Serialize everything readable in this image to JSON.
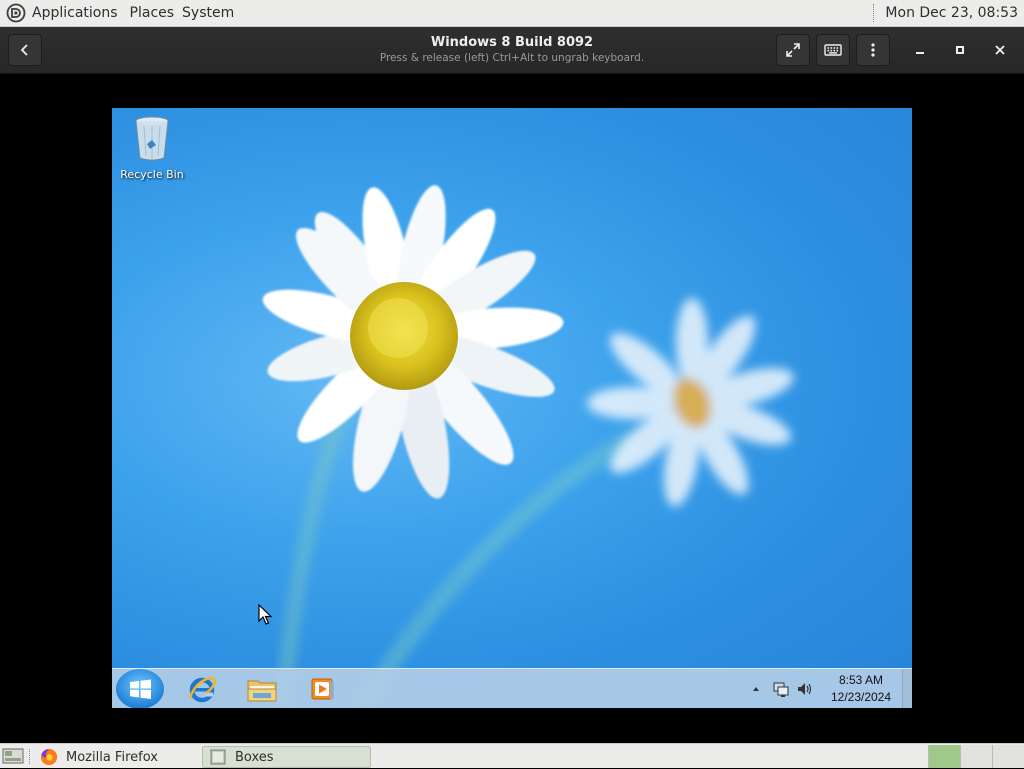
{
  "top_panel": {
    "menus": [
      "Applications",
      "Places",
      "System"
    ],
    "clock": "Mon Dec 23, 08:53"
  },
  "header": {
    "title": "Windows 8 Build 8092",
    "subtitle": "Press & release (left) Ctrl+Alt to ungrab keyboard."
  },
  "desktop": {
    "icons": [
      {
        "label": "Recycle Bin",
        "icon": "recycle-bin-icon"
      }
    ]
  },
  "taskbar": {
    "pinned": [
      "internet-explorer-icon",
      "file-explorer-icon",
      "media-player-icon"
    ],
    "clock_time": "8:53 AM",
    "clock_date": "12/23/2024"
  },
  "bottom_panel": {
    "tasks": [
      {
        "label": "Mozilla Firefox",
        "active": false
      },
      {
        "label": "Boxes",
        "active": true
      }
    ]
  },
  "colors": {
    "accent": "#2d8fe0",
    "panel_bg": "#ecedea",
    "header_bg": "#2b2b2b"
  }
}
